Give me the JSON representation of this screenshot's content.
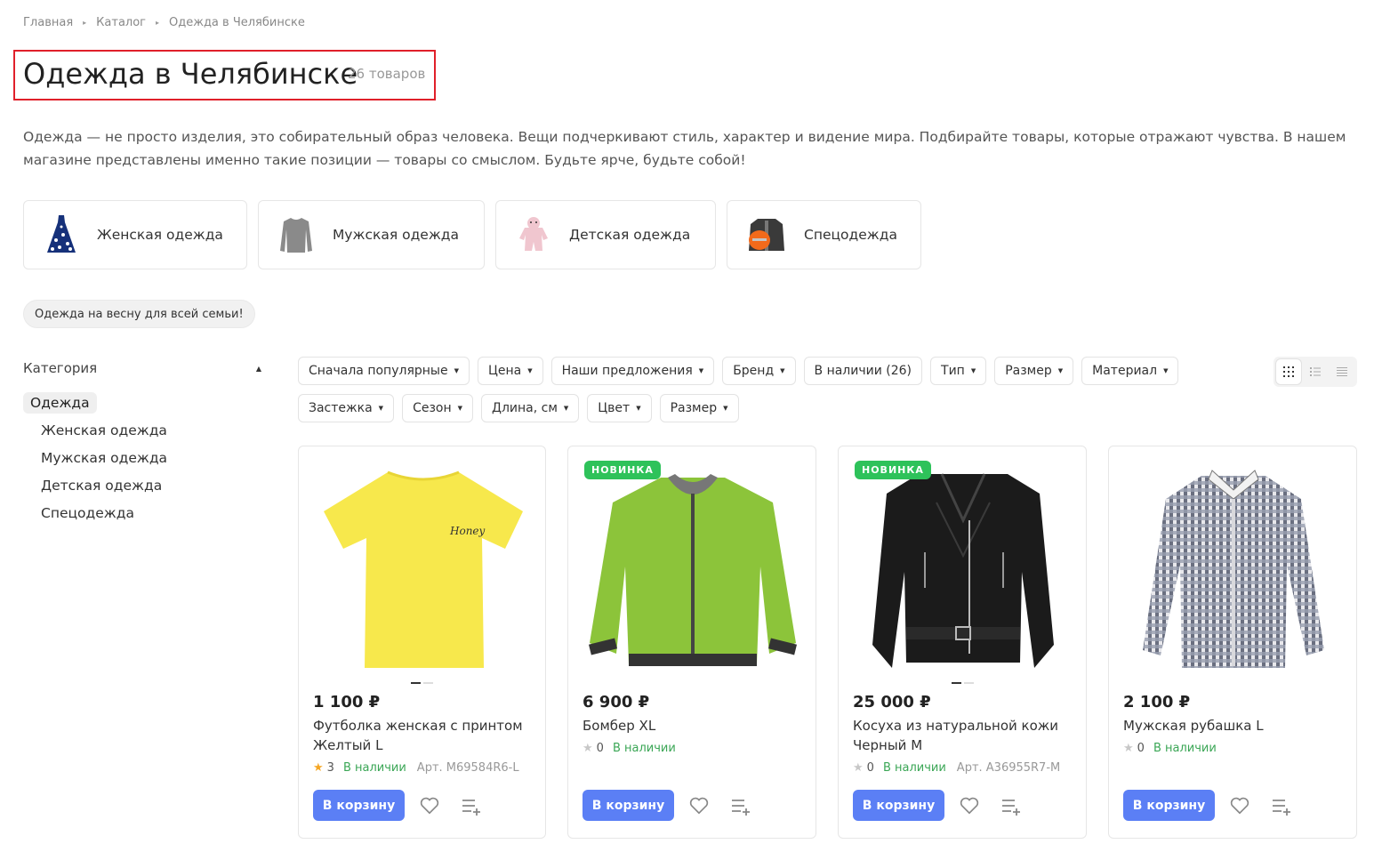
{
  "breadcrumbs": [
    "Главная",
    "Каталог",
    "Одежда в Челябинске"
  ],
  "page": {
    "title": "Одежда в Челябинске",
    "count": "26 товаров",
    "description": "Одежда — не просто изделия, это собирательный образ человека. Вещи подчеркивают стиль, характер и видение мира. Подбирайте товары, которые отражают чувства. В нашем магазине представлены именно такие позиции — товары со смыслом. Будьте ярче, будьте собой!"
  },
  "category_tiles": [
    {
      "label": "Женская одежда",
      "icon": "dress-icon"
    },
    {
      "label": "Мужская одежда",
      "icon": "sweater-icon"
    },
    {
      "label": "Детская одежда",
      "icon": "baby-suit-icon"
    },
    {
      "label": "Спецодежда",
      "icon": "workwear-icon"
    }
  ],
  "promo_tag": "Одежда на весну для всей семьи!",
  "sidebar": {
    "heading": "Категория",
    "active": "Одежда",
    "items": [
      "Женская одежда",
      "Мужская одежда",
      "Детская одежда",
      "Спецодежда"
    ]
  },
  "filters": [
    "Сначала популярные",
    "Цена",
    "Наши предложения",
    "Бренд",
    "В наличии (26)",
    "Тип",
    "Размер",
    "Материал",
    "Застежка",
    "Сезон",
    "Длина, см",
    "Цвет",
    "Размер"
  ],
  "view_modes": [
    "grid-view-icon",
    "list-view-icon",
    "table-view-icon"
  ],
  "products": [
    {
      "price": "1 100 ₽",
      "name": "Футболка женская с принтом Желтый L",
      "rating": "3",
      "rated": true,
      "stock": "В наличии",
      "article": "Арт. M69584R6-L",
      "badge": "",
      "button": "В корзину",
      "image": "yellow-tshirt",
      "color": "#f7e84c",
      "slides": 2
    },
    {
      "price": "6 900 ₽",
      "name": "Бомбер XL",
      "rating": "0",
      "rated": false,
      "stock": "В наличии",
      "article": "",
      "badge": "НОВИНКА",
      "button": "В корзину",
      "image": "green-bomber",
      "color": "#8cc43a",
      "slides": 0
    },
    {
      "price": "25 000 ₽",
      "name": "Косуха из натуральной кожи Черный M",
      "rating": "0",
      "rated": false,
      "stock": "В наличии",
      "article": "Арт. A36955R7-M",
      "badge": "НОВИНКА",
      "button": "В корзину",
      "image": "leather-jacket",
      "color": "#1b1b1b",
      "slides": 2
    },
    {
      "price": "2 100 ₽",
      "name": "Мужская рубашка L",
      "rating": "0",
      "rated": false,
      "stock": "В наличии",
      "article": "",
      "badge": "",
      "button": "В корзину",
      "image": "checked-shirt",
      "color": "#5a5f6e",
      "slides": 0
    }
  ],
  "colors": {
    "accent": "#5b7ff5",
    "badge": "#2ec25a",
    "stock": "#3aa655",
    "star": "#f5a623",
    "title_outline": "#e0202a"
  }
}
